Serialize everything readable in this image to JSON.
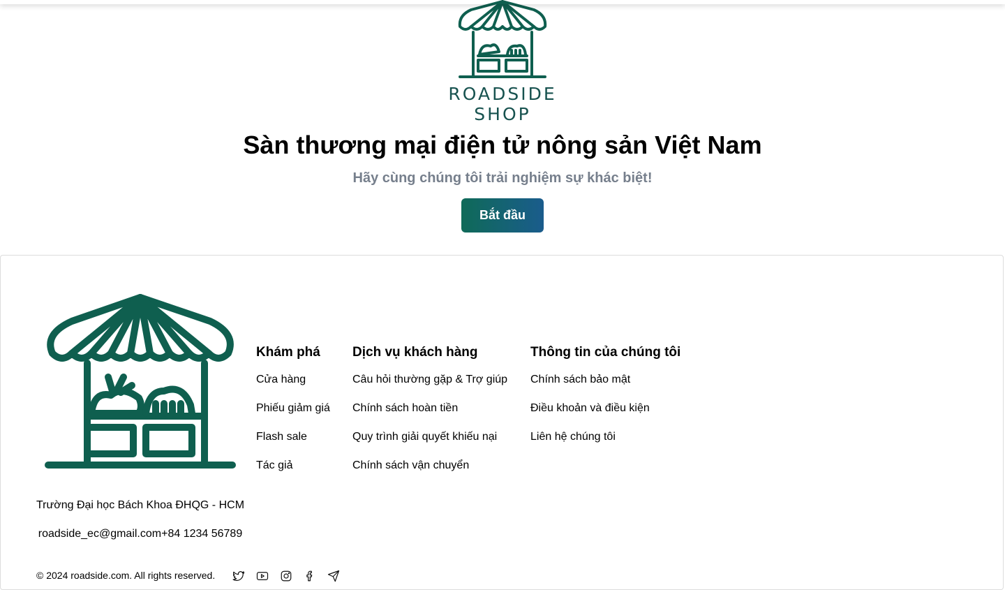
{
  "hero": {
    "brand_line1": "ROADSIDE",
    "brand_line2": "SHOP",
    "title": "Sàn thương mại điện tử nông sản Việt Nam",
    "subtitle": "Hãy cùng chúng tôi trải nghiệm sự khác biệt!",
    "start_label": "Bắt đầu"
  },
  "colors": {
    "brand_green": "#0f5f4f",
    "button_gradient_start": "#0f6a58",
    "button_gradient_end": "#1a5c8c",
    "subtitle_gray": "#767f8c"
  },
  "footer": {
    "columns": [
      {
        "heading": "Khám phá",
        "links": [
          "Cửa hàng",
          "Phiếu giảm giá",
          "Flash sale",
          "Tác giả"
        ]
      },
      {
        "heading": "Dịch vụ khách hàng",
        "links": [
          "Câu hỏi thường gặp & Trợ giúp",
          "Chính sách hoàn tiền",
          "Quy trình giải quyết khiếu nại",
          "Chính sách vận chuyển"
        ]
      },
      {
        "heading": "Thông tin của chúng tôi",
        "links": [
          "Chính sách bảo mật",
          "Điều khoản và điều kiện",
          "Liên hệ chúng tôi"
        ]
      }
    ],
    "address": "Trường Đại học Bách Khoa ĐHQG - HCM",
    "contact": "roadside_ec@gmail.com+84 1234 56789",
    "copyright": "© 2024 roadside.com. All rights reserved.",
    "socials": [
      "twitter-icon",
      "youtube-icon",
      "instagram-icon",
      "facebook-icon",
      "telegram-icon"
    ]
  }
}
